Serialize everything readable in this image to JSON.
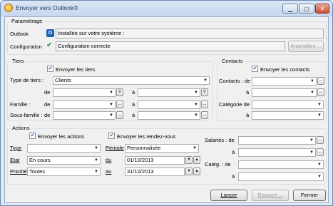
{
  "window": {
    "title": "Envoyer vers Outlook®"
  },
  "parametrage": {
    "title": "Paramétrage",
    "outlook_label": "Outlook",
    "outlook_status": "Installée sur votre système :",
    "config_label": "Configuration",
    "config_status": "Configuration correcte",
    "anomalies_button": "Anomalies ..."
  },
  "tiers": {
    "title": "Tiers",
    "send_label": "Envoyer les tiers",
    "type_label": "Type de tiers :",
    "type_value": "Clients",
    "de": "de",
    "a": "à",
    "famille_label": "Famille :",
    "sousfamille_label": "Sous-famille :"
  },
  "contacts": {
    "title": "Contacts",
    "send_label": "Envoyer les contacts",
    "contacts_de": "Contacts : de",
    "a": "à",
    "categorie_label": "Catégorie de"
  },
  "actions": {
    "title": "Actions",
    "send_actions": "Envoyer les actions",
    "send_rdv": "Envoyer les rendez-vous",
    "type_label": "Type",
    "etat_label": "Etat",
    "etat_value": "En cours",
    "priorite_label": "Priorité",
    "priorite_value": "Toutes",
    "periode_label": "Période",
    "periode_value": "Personnalisée",
    "du_label": "du",
    "du_value": "01/10/2013",
    "au_label": "au",
    "au_value": "31/10/2013",
    "salaries_label": "Salariés : de",
    "categ_label": "Catég. : de",
    "a": "à"
  },
  "buttons": {
    "lancer": "Lancer",
    "rapport": "Rapport ...",
    "fermer": "Fermer"
  },
  "icons": {
    "outlook": "O",
    "check": "✔",
    "binoculars": "⚲",
    "dots": "..."
  }
}
